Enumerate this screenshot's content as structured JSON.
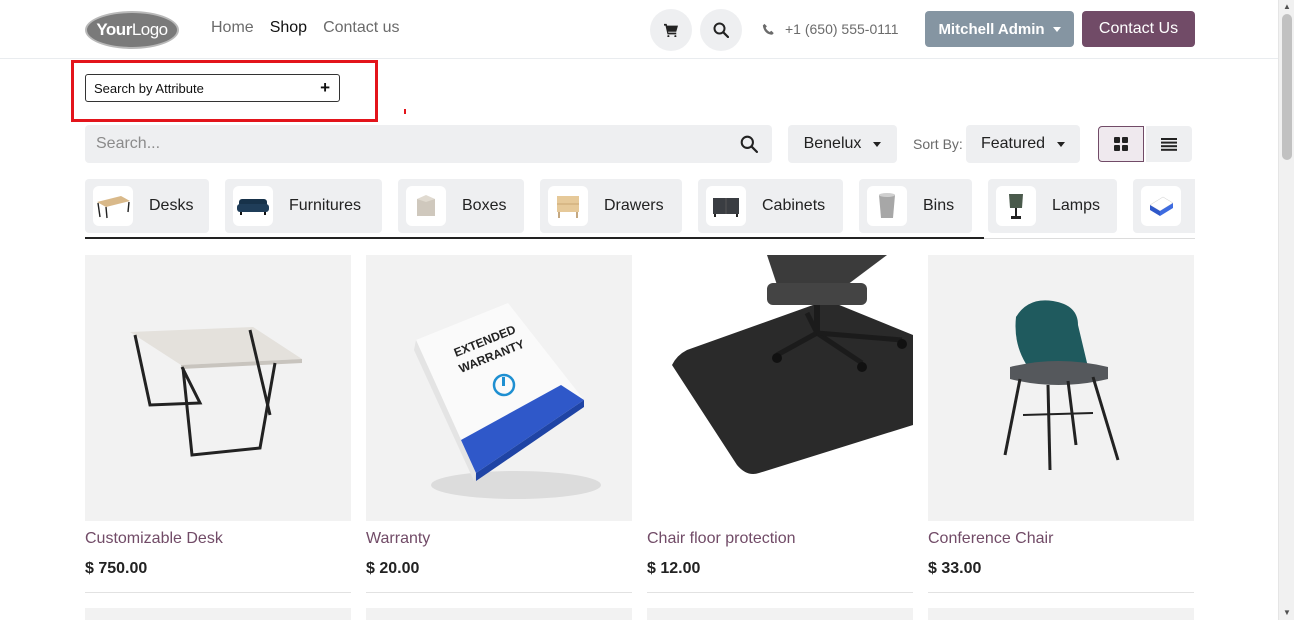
{
  "header": {
    "logo_text_bold": "Your",
    "logo_text_thin": "Logo",
    "nav": [
      {
        "label": "Home"
      },
      {
        "label": "Shop"
      },
      {
        "label": "Contact us"
      }
    ],
    "phone": "+1 (650) 555-0111",
    "user_label": "Mitchell Admin",
    "contact_button": "Contact Us"
  },
  "attribute_search": {
    "label": "Search by Attribute"
  },
  "search": {
    "placeholder": "Search..."
  },
  "filters": {
    "pricelist": "Benelux",
    "sort_label": "Sort By:",
    "sort_value": "Featured"
  },
  "categories": [
    {
      "label": "Desks"
    },
    {
      "label": "Furnitures"
    },
    {
      "label": "Boxes"
    },
    {
      "label": "Drawers"
    },
    {
      "label": "Cabinets"
    },
    {
      "label": "Bins"
    },
    {
      "label": "Lamps"
    }
  ],
  "products": [
    {
      "name": "Customizable Desk",
      "price": "$ 750.00"
    },
    {
      "name": "Warranty",
      "price": "$ 20.00"
    },
    {
      "name": "Chair floor protection",
      "price": "$ 12.00"
    },
    {
      "name": "Conference Chair",
      "price": "$ 33.00"
    }
  ],
  "colors": {
    "brand": "#714b67",
    "user_button": "#8595a2",
    "highlight": "#e3141b"
  }
}
